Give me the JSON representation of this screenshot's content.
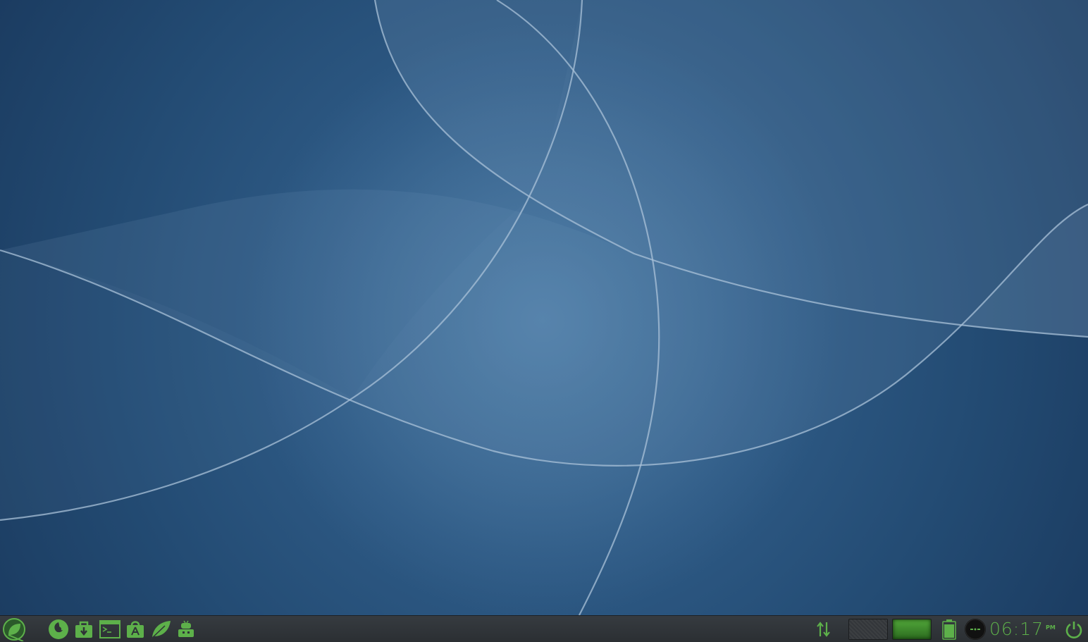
{
  "wallpaper": {
    "base_color": "#2e5a85",
    "line_color": "#a9c2d8"
  },
  "taskbar": {
    "background": "#2f3337",
    "accent": "#5db04a",
    "launchers": [
      {
        "name": "menu-leaf-icon"
      },
      {
        "name": "firefox-icon"
      },
      {
        "name": "software-store-icon"
      },
      {
        "name": "terminal-icon"
      },
      {
        "name": "app-store-icon"
      },
      {
        "name": "leaf-icon"
      },
      {
        "name": "robot-icon"
      }
    ],
    "tray": {
      "network_icon": "network-updown-icon",
      "workspaces": [
        "workspace-1",
        "workspace-2"
      ],
      "active_workspace": 2,
      "battery_icon": "battery-icon",
      "battery_level": 0.9,
      "media_icon": "media-player-icon",
      "power_icon": "power-icon"
    },
    "clock": {
      "time": "06:17",
      "ampm": "PM"
    }
  }
}
